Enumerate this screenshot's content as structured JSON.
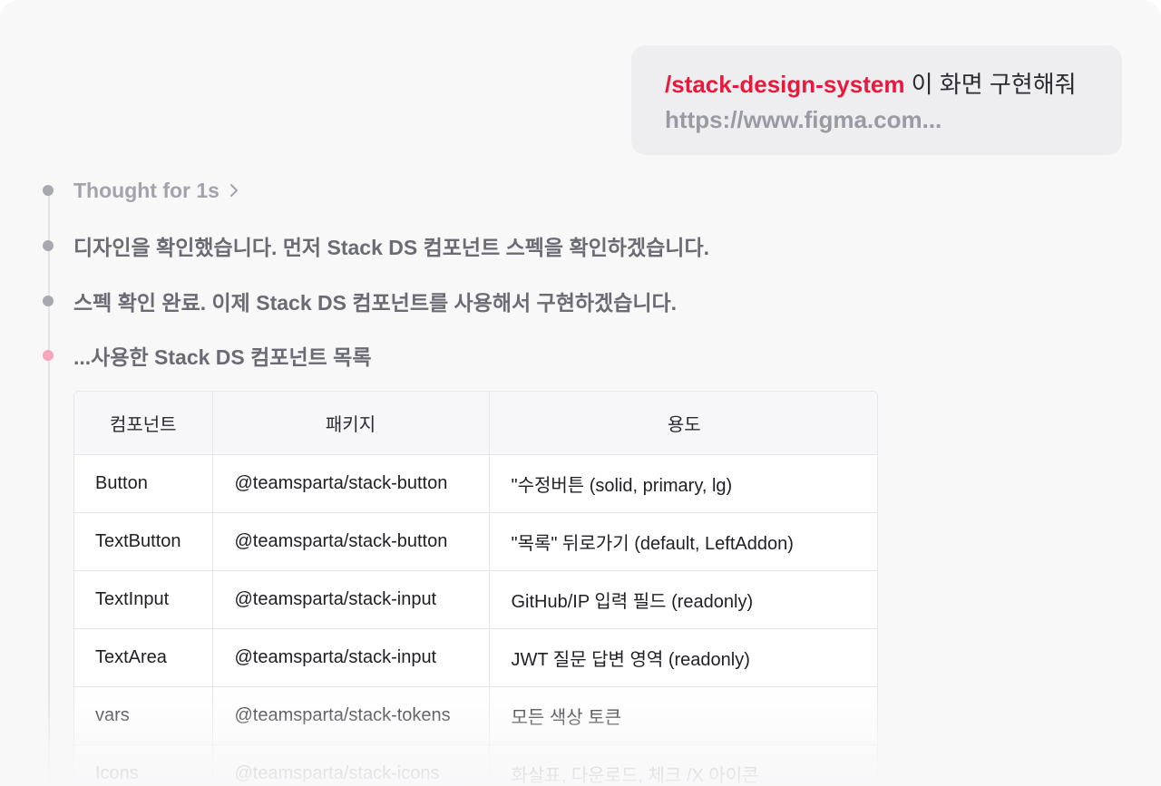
{
  "user_message": {
    "command": "/stack-design-system",
    "text": " 이 화면 구현해줘",
    "link": "https://www.figma.com..."
  },
  "steps": [
    {
      "label": "Thought for 1s"
    },
    {
      "label": "디자인을 확인했습니다. 먼저 Stack DS 컴포넌트 스펙을 확인하겠습니다."
    },
    {
      "label": "스펙 확인 완료. 이제 Stack DS 컴포넌트를 사용해서 구현하겠습니다."
    },
    {
      "label": "...사용한 Stack DS 컴포넌트 목록"
    }
  ],
  "table": {
    "headers": [
      "컴포넌트",
      "패키지",
      "용도"
    ],
    "rows": [
      [
        "Button",
        "@teamsparta/stack-button",
        "\"수정버튼 (solid, primary, lg)"
      ],
      [
        "TextButton",
        "@teamsparta/stack-button",
        "\"목록\" 뒤로가기 (default, LeftAddon)"
      ],
      [
        "TextInput",
        "@teamsparta/stack-input",
        "GitHub/IP 입력 필드 (readonly)"
      ],
      [
        "TextArea",
        "@teamsparta/stack-input",
        "JWT 질문 답변 영역 (readonly)"
      ],
      [
        "vars",
        "@teamsparta/stack-tokens",
        "모든 색상 토큰"
      ],
      [
        "Icons",
        "@teamsparta/stack-icons",
        "화살표, 다운로드, 체크 /X 아이콘"
      ]
    ]
  },
  "icons": {
    "expand": "chevron-right-icon"
  },
  "colors": {
    "accent": "#e8193c",
    "active_dot": "#f6a6b6",
    "dot": "#a8a8b0"
  }
}
